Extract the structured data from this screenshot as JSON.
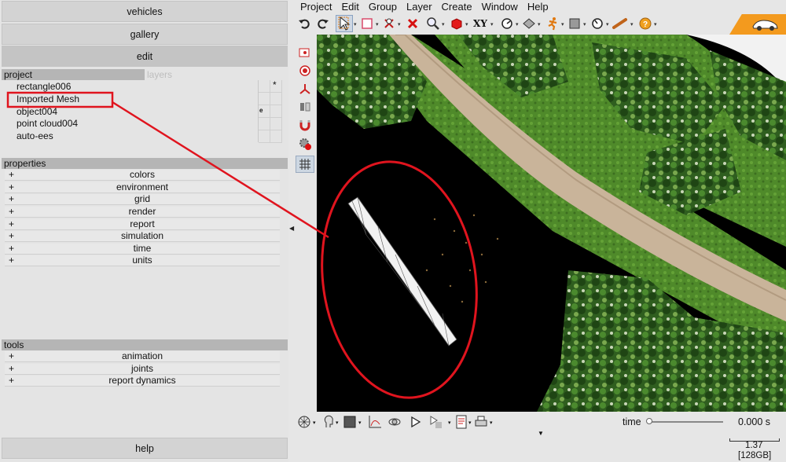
{
  "nav": {
    "vehicles": "vehicles",
    "gallery": "gallery",
    "edit": "edit",
    "help": "help"
  },
  "project": {
    "header": "project",
    "layers_label": "layers",
    "items": [
      "rectangle006",
      "Imported Mesh",
      "object004",
      "point cloud004",
      "auto-ees"
    ],
    "layer_marks": [
      "*",
      "e"
    ]
  },
  "properties": {
    "header": "properties",
    "rows": [
      "colors",
      "environment",
      "grid",
      "render",
      "report",
      "simulation",
      "time",
      "units"
    ]
  },
  "tools": {
    "header": "tools",
    "rows": [
      "animation",
      "joints",
      "report dynamics"
    ]
  },
  "plus": "+",
  "menu": [
    "Project",
    "Edit",
    "Group",
    "Layer",
    "Create",
    "Window",
    "Help"
  ],
  "toolbar": {
    "xy_label": "XY",
    "icons": [
      "undo-icon",
      "redo-icon",
      "select-arrow-icon",
      "rectangle-select-icon",
      "pin-icon",
      "delete-icon",
      "zoom-icon",
      "cube-icon",
      "xy-plane-icon",
      "measure-icon",
      "tag-icon",
      "runner-icon",
      "box-icon",
      "gauge-icon",
      "bat-icon",
      "help-icon"
    ]
  },
  "time": {
    "label": "time",
    "value": "0.000 s",
    "position": 0
  },
  "status": {
    "scale": "1.37",
    "memory": "[128GB]"
  },
  "colors": {
    "highlight_red": "#e0141e",
    "brand_orange": "#f39a1e",
    "road": "#c9b49a",
    "vegetation": "#3f7d25"
  }
}
